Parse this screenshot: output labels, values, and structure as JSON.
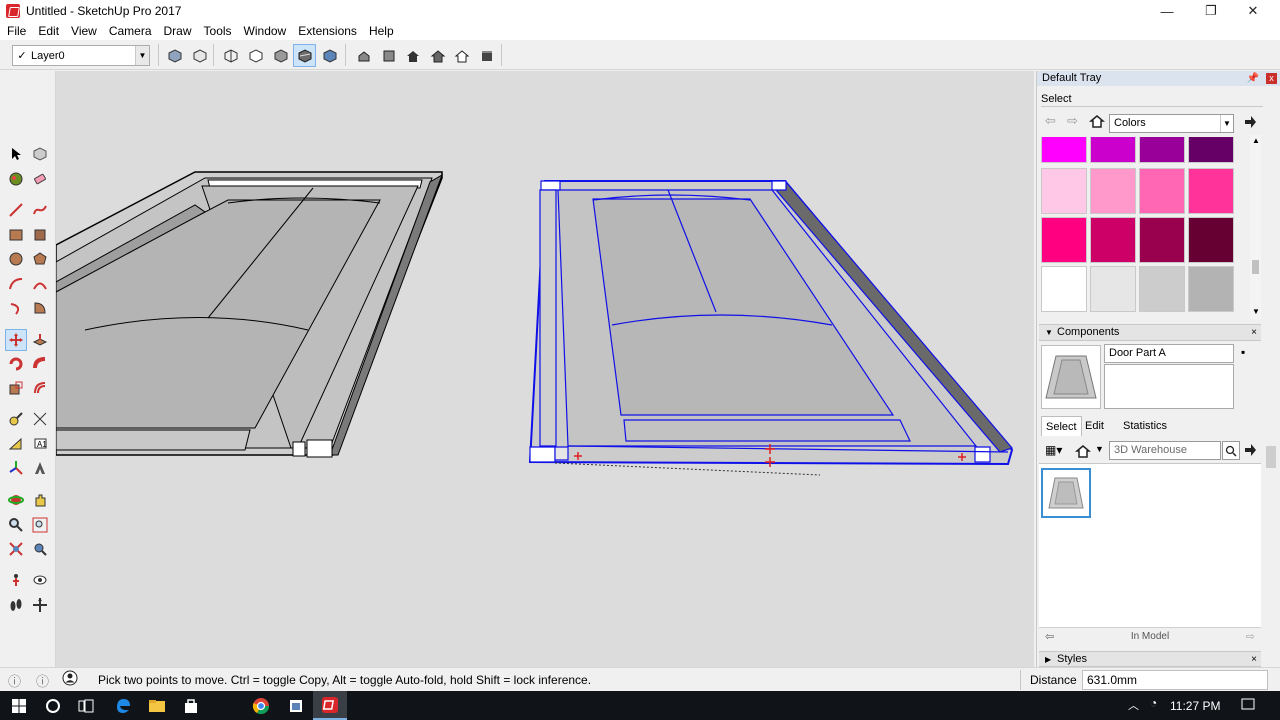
{
  "window": {
    "title": "Untitled - SketchUp Pro 2017",
    "controls": [
      "—",
      "❐",
      "✕"
    ]
  },
  "menu": [
    "File",
    "Edit",
    "View",
    "Camera",
    "Draw",
    "Tools",
    "Window",
    "Extensions",
    "Help"
  ],
  "toolbar": {
    "layer_check": "✓",
    "layer_name": "Layer0",
    "buttons": [
      "xray-icon",
      "back-edges-icon",
      "wireframe-icon",
      "hidden-line-icon",
      "shaded-icon",
      "shaded-textures-icon",
      "monochrome-icon",
      "iso-view-icon",
      "top-view-icon",
      "front-view-icon",
      "right-view-icon",
      "back-view-icon",
      "left-view-icon"
    ]
  },
  "tray": {
    "title": "Default Tray",
    "pin": "📌",
    "close": "x",
    "materials": {
      "select_label": "Select",
      "library": "Colors",
      "swatches_top": [
        "#ff00ff",
        "#cc00cc",
        "#990099",
        "#660066"
      ],
      "swatches": [
        [
          "#ffc8e6",
          "#ff99cc",
          "#ff66b3",
          "#ff3399"
        ],
        [
          "#ff0080",
          "#cc0066",
          "#99004d",
          "#660033"
        ],
        [
          "#ffffff",
          "#e6e6e6",
          "#cccccc",
          "#b3b3b3"
        ]
      ]
    },
    "components": {
      "title": "Components",
      "name": "Door Part A",
      "tabs": [
        "Select",
        "Edit",
        "Statistics"
      ],
      "search_placeholder": "3D Warehouse",
      "footer": "In Model"
    },
    "styles": {
      "title": "Styles"
    }
  },
  "status": {
    "message": "Pick two points to move.  Ctrl = toggle Copy, Alt = toggle Auto-fold, hold Shift = lock inference.",
    "measure_label": "Distance",
    "measure_value": "631.0mm"
  },
  "taskbar": {
    "time": "11:27 PM"
  }
}
